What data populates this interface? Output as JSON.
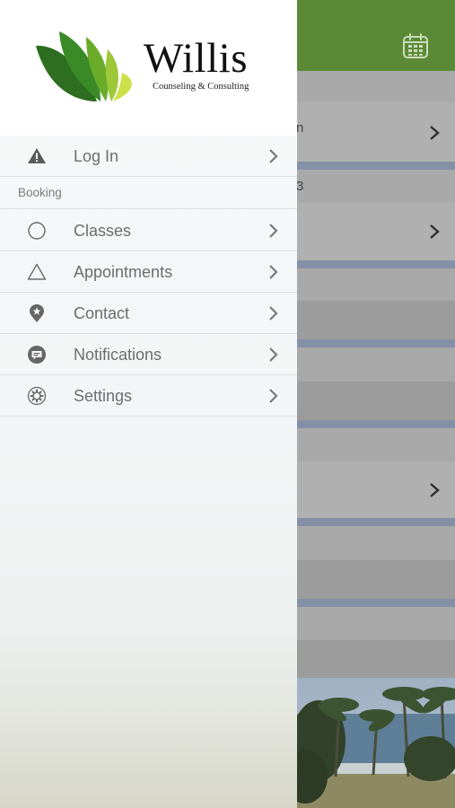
{
  "background_app": {
    "header_color": "#5b8a36",
    "calendar_button_icon": "calendar-icon",
    "fragments": [
      "n",
      "3"
    ]
  },
  "brand": {
    "name": "Willis",
    "tagline": "Counseling & Consulting"
  },
  "drawer": {
    "login": {
      "label": "Log In",
      "icon": "warning-icon"
    },
    "section_header": "Booking",
    "items": [
      {
        "label": "Classes",
        "icon": "circle-icon"
      },
      {
        "label": "Appointments",
        "icon": "triangle-icon"
      },
      {
        "label": "Contact",
        "icon": "location-pin-star-icon"
      },
      {
        "label": "Notifications",
        "icon": "chat-bubble-icon"
      },
      {
        "label": "Settings",
        "icon": "gear-icon"
      }
    ]
  }
}
